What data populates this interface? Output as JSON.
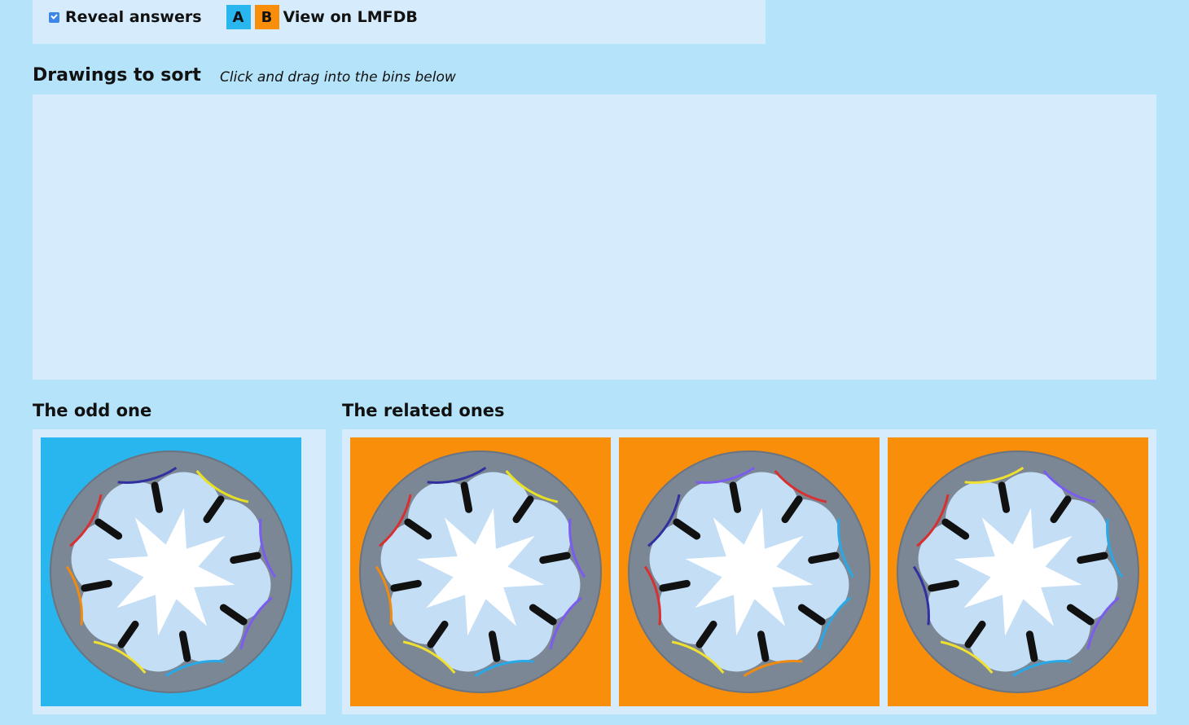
{
  "toolbar": {
    "reveal_label": "Reveal answers",
    "reveal_checked": true,
    "badge_a": "A",
    "badge_b": "B",
    "lmfdb_label": "View on LMFDB"
  },
  "sort": {
    "heading": "Drawings to sort",
    "hint": "Click and drag into the bins below"
  },
  "bins": {
    "odd": {
      "heading": "The odd one"
    },
    "related": {
      "heading": "The related ones"
    }
  },
  "colors": {
    "page_bg": "#b5e3f9",
    "panel_bg": "#d6ecfc",
    "card_a": "#29b6ee",
    "card_b": "#f98e0a",
    "disk": "#7b8794",
    "tile": "#c4def6"
  },
  "cards": [
    {
      "bin": "odd",
      "group": "A"
    },
    {
      "bin": "related",
      "group": "B"
    },
    {
      "bin": "related",
      "group": "B"
    },
    {
      "bin": "related",
      "group": "B"
    }
  ]
}
